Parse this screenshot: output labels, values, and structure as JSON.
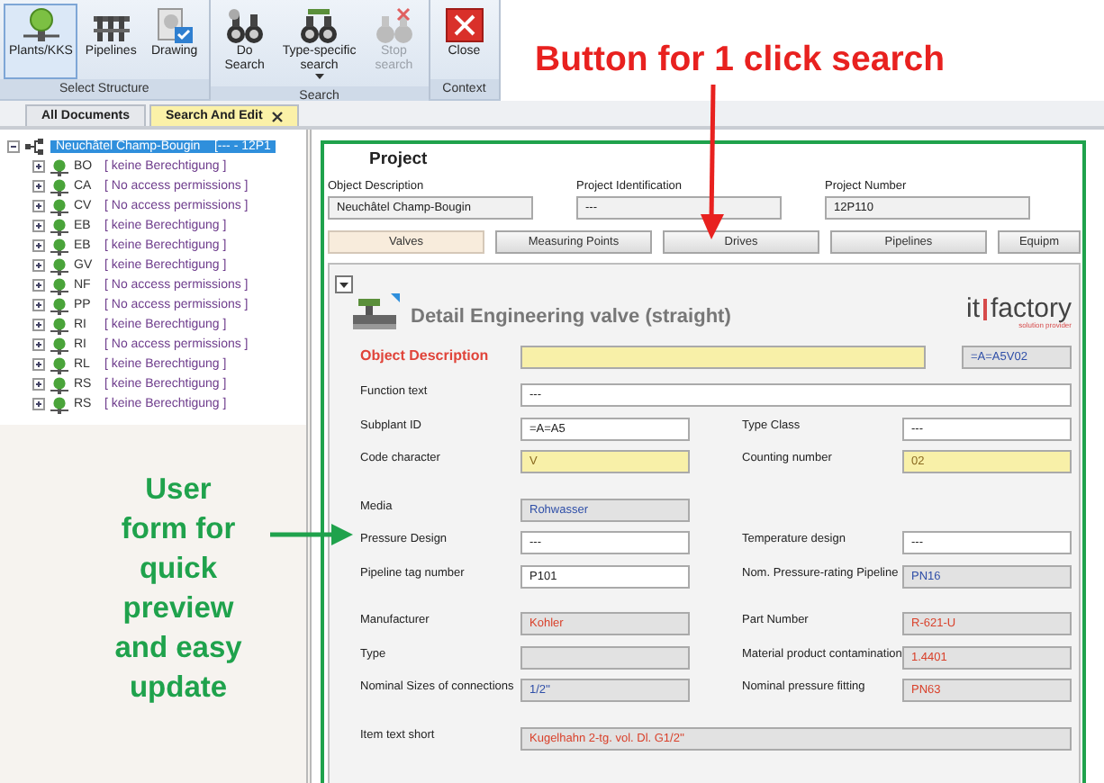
{
  "ribbon": {
    "groups": [
      {
        "label": "Select Structure",
        "buttons": [
          {
            "lines": [
              "Plants/KKS"
            ],
            "kind": "plant",
            "selected": true,
            "disabled": false,
            "dropdown": false
          },
          {
            "lines": [
              "Pipelines"
            ],
            "kind": "pipes",
            "selected": false,
            "disabled": false,
            "dropdown": false
          },
          {
            "lines": [
              "Drawing"
            ],
            "kind": "drawing",
            "selected": false,
            "disabled": false,
            "dropdown": false
          }
        ]
      },
      {
        "label": "Search",
        "buttons": [
          {
            "lines": [
              "Do",
              "Search"
            ],
            "kind": "binoculars",
            "selected": false,
            "disabled": false,
            "dropdown": false
          },
          {
            "lines": [
              "Type-specific",
              "search"
            ],
            "kind": "binoculars-tagged",
            "selected": false,
            "disabled": false,
            "dropdown": true
          },
          {
            "lines": [
              "Stop",
              "search"
            ],
            "kind": "binoculars-stop",
            "selected": false,
            "disabled": true,
            "dropdown": false
          }
        ]
      },
      {
        "label": "Context",
        "buttons": [
          {
            "lines": [
              "Close"
            ],
            "kind": "close",
            "selected": false,
            "disabled": false,
            "dropdown": false
          }
        ]
      }
    ]
  },
  "doc_tabs": [
    {
      "label": "All Documents",
      "selected": false,
      "closable": false
    },
    {
      "label": "Search And Edit",
      "selected": true,
      "closable": true
    }
  ],
  "tree": {
    "label": "Neuchâtel Champ-Bougin",
    "detail": "[--- - 12P1",
    "selected": true,
    "expanded": true,
    "children": [
      {
        "code": "BO",
        "note": "[ keine Berechtigung ]",
        "expanded": false
      },
      {
        "code": "CA",
        "note": "[ No access permissions ]",
        "expanded": false
      },
      {
        "code": "CV",
        "note": "[ No access permissions ]",
        "expanded": false
      },
      {
        "code": "EB",
        "note": "[ keine Berechtigung ]",
        "expanded": false
      },
      {
        "code": "EB",
        "note": "[ keine Berechtigung ]",
        "expanded": false
      },
      {
        "code": "GV",
        "note": "[ keine Berechtigung ]",
        "expanded": false
      },
      {
        "code": "NF",
        "note": "[ No access permissions ]",
        "expanded": false
      },
      {
        "code": "PP",
        "note": "[ No access permissions ]",
        "expanded": false
      },
      {
        "code": "RI",
        "note": "[ keine Berechtigung ]",
        "expanded": false
      },
      {
        "code": "RI",
        "note": "[ No access permissions ]",
        "expanded": false
      },
      {
        "code": "RL",
        "note": "[ keine Berechtigung ]",
        "expanded": false
      },
      {
        "code": "RS",
        "note": "[ keine Berechtigung ]",
        "expanded": false
      },
      {
        "code": "RS",
        "note": "[ keine Berechtigung ]",
        "expanded": false
      }
    ]
  },
  "project": {
    "title": "Project",
    "fields": [
      {
        "label": "Object Description",
        "value": "Neuchâtel Champ-Bougin"
      },
      {
        "label": "Project Identification",
        "value": "---"
      },
      {
        "label": "Project Number",
        "value": "12P110"
      }
    ]
  },
  "object_tabs": [
    {
      "label": "Valves",
      "selected": true
    },
    {
      "label": "Measuring Points",
      "selected": false
    },
    {
      "label": "Drives",
      "selected": false
    },
    {
      "label": "Pipelines",
      "selected": false
    },
    {
      "label": "Equipm",
      "selected": false
    }
  ],
  "detail": {
    "title": "Detail Engineering valve (straight)",
    "logo": {
      "left": "it",
      "right": "factory",
      "tagline": "solution provider"
    },
    "groups": [
      [
        {
          "kind": "heading",
          "label": "Object Description",
          "field": {
            "kind": "required"
          },
          "code": {
            "kind": "readonly",
            "value": "=A=A5V02",
            "color": "#2f4fa8"
          }
        },
        {
          "kind": "wide",
          "label": "Function text",
          "field": {
            "kind": "input",
            "value": "---",
            "color": "#222222"
          }
        },
        {
          "kind": "pair",
          "items": [
            {
              "label": "Subplant ID",
              "field": {
                "kind": "input",
                "value": "=A=A5",
                "color": "#222222"
              }
            },
            {
              "label": "Type Class",
              "field": {
                "kind": "input",
                "value": "---",
                "color": "#222222"
              }
            }
          ]
        },
        {
          "kind": "pair",
          "items": [
            {
              "label": "Code character",
              "field": {
                "kind": "required",
                "value": "V"
              }
            },
            {
              "label": "Counting number",
              "field": {
                "kind": "required",
                "value": "02"
              }
            }
          ]
        }
      ],
      [
        {
          "kind": "pair",
          "items": [
            {
              "label": "Media",
              "field": {
                "kind": "readonly",
                "value": "Rohwasser",
                "color": "#2f4fa8"
              }
            }
          ]
        },
        {
          "kind": "pair",
          "items": [
            {
              "label": "Pressure Design",
              "field": {
                "kind": "input",
                "value": "---",
                "color": "#222222"
              }
            },
            {
              "label": "Temperature design",
              "field": {
                "kind": "input",
                "value": "---",
                "color": "#222222"
              }
            }
          ]
        },
        {
          "kind": "pair",
          "items": [
            {
              "label": "Pipeline tag number",
              "field": {
                "kind": "input",
                "value": "P101",
                "color": "#222222"
              }
            },
            {
              "label": "Nom. Pressure-rating Pipeline",
              "field": {
                "kind": "readonly",
                "value": "PN16",
                "color": "#2f4fa8"
              }
            }
          ]
        }
      ],
      [
        {
          "kind": "pair",
          "items": [
            {
              "label": "Manufacturer",
              "field": {
                "kind": "readonly",
                "value": "Kohler",
                "color": "#d9412b"
              }
            },
            {
              "label": "Part Number",
              "field": {
                "kind": "readonly",
                "value": "R-621-U",
                "color": "#d9412b"
              }
            }
          ]
        },
        {
          "kind": "pair",
          "items": [
            {
              "label": "Type",
              "field": {
                "kind": "readonly"
              }
            },
            {
              "label": "Material product contamination",
              "field": {
                "kind": "readonly",
                "value": "1.4401",
                "color": "#d9412b"
              }
            }
          ]
        },
        {
          "kind": "pair",
          "items": [
            {
              "label": "Nominal Sizes of connections",
              "field": {
                "kind": "readonly",
                "value": "1/2''",
                "color": "#2f4fa8"
              }
            },
            {
              "label": "Nominal pressure fitting",
              "field": {
                "kind": "readonly",
                "value": "PN63",
                "color": "#d9412b"
              }
            }
          ]
        }
      ],
      [
        {
          "kind": "wide",
          "label": "Item text short",
          "field": {
            "kind": "readonly",
            "value": "Kugelhahn 2-tg. vol. Dl. G1/2''",
            "color": "#d9412b"
          }
        }
      ]
    ]
  },
  "annotations": [
    {
      "kind": "red-callout",
      "text": "Button for 1 click search"
    },
    {
      "kind": "green-callout",
      "text": "User\nform for\nquick\npreview\nand easy\nupdate"
    }
  ]
}
